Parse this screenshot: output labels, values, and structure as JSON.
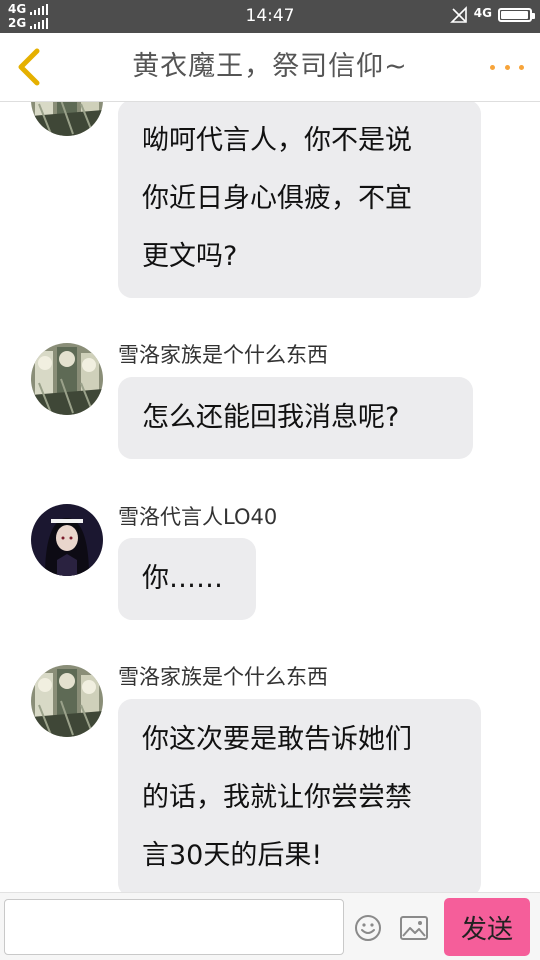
{
  "status_bar": {
    "network_left_top": "4G",
    "network_left_bottom": "2G",
    "time": "14:47",
    "network_right": "4G",
    "battery_level": 0.95
  },
  "header": {
    "title": "黄衣魔王，祭司信仰~",
    "back_icon": "chevron-left-icon",
    "more_icon": "more-dots-icon",
    "accent_color": "#f7a43a"
  },
  "messages": [
    {
      "sender": "",
      "avatar": "group-avatar",
      "lines": [
        "呦呵代言人，你不是说",
        "你近日身心俱疲，不宜",
        "更文吗?"
      ]
    },
    {
      "sender": "雪洛家族是个什么东西",
      "avatar": "group-avatar",
      "lines": [
        "怎么还能回我消息呢?"
      ]
    },
    {
      "sender": "雪洛代言人LO40",
      "avatar": "girl-avatar",
      "lines": [
        "你……"
      ]
    },
    {
      "sender": "雪洛家族是个什么东西",
      "avatar": "group-avatar",
      "lines": [
        "你这次要是敢告诉她们",
        "的话，我就让你尝尝禁",
        "言30天的后果!"
      ]
    }
  ],
  "input_bar": {
    "placeholder": "",
    "emoji_icon": "smiley-icon",
    "image_icon": "image-icon",
    "send_label": "发送",
    "send_color": "#f55e9a"
  }
}
